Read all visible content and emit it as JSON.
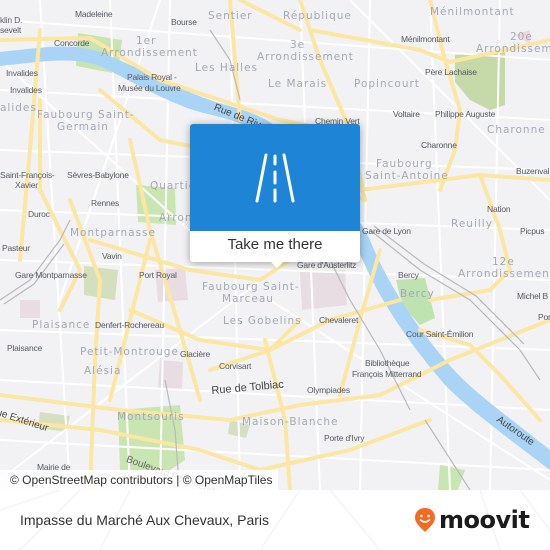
{
  "map": {
    "districts": [
      {
        "text": "Sentier"
      },
      {
        "text": "République"
      },
      {
        "text": "Ménilmontant"
      },
      {
        "text": "1er"
      },
      {
        "text": "Arrondissement"
      },
      {
        "text": "3e"
      },
      {
        "text": "Arrondissement"
      },
      {
        "text": "20e"
      },
      {
        "text": "Arrondissement"
      },
      {
        "text": "Les Halles"
      },
      {
        "text": "Le Marais"
      },
      {
        "text": "Popincourt"
      },
      {
        "text": "Charonne"
      },
      {
        "text": "Faubourg Saint-"
      },
      {
        "text": "Germain"
      },
      {
        "text": "Faubourg"
      },
      {
        "text": "Saint-Antoine"
      },
      {
        "text": "Quartie"
      },
      {
        "text": "Arron"
      },
      {
        "text": "Montparnasse"
      },
      {
        "text": "Reuilly"
      },
      {
        "text": "12e"
      },
      {
        "text": "Arrondissement"
      },
      {
        "text": "Bercy"
      },
      {
        "text": "Faubourg Saint-"
      },
      {
        "text": "Marceau"
      },
      {
        "text": "Les Gobelins"
      },
      {
        "text": "Plaisance"
      },
      {
        "text": "Petit-Montrouge"
      },
      {
        "text": "Alésia"
      },
      {
        "text": "Montsouris"
      },
      {
        "text": "Maison-Blanche"
      },
      {
        "text": "alides"
      }
    ],
    "stations": [
      {
        "text": "Madeleine"
      },
      {
        "text": "Bourse"
      },
      {
        "text": "Concorde"
      },
      {
        "text": "Palais Royal -"
      },
      {
        "text": "Musée du Louvre"
      },
      {
        "text": "Invalides"
      },
      {
        "text": "Invalides"
      },
      {
        "text": "Ménilmontant"
      },
      {
        "text": "Père Lachaise"
      },
      {
        "text": "Chemin Vert"
      },
      {
        "text": "Voltaire"
      },
      {
        "text": "Philippe Auguste"
      },
      {
        "text": "Charonne"
      },
      {
        "text": "Buzenval"
      },
      {
        "text": "Saint-François-"
      },
      {
        "text": "Xavier"
      },
      {
        "text": "Sèvres-Babylone"
      },
      {
        "text": "Rennes"
      },
      {
        "text": "Duroc"
      },
      {
        "text": "Pasteur"
      },
      {
        "text": "Vavin"
      },
      {
        "text": "Gare Montparnasse"
      },
      {
        "text": "Port Royal"
      },
      {
        "text": "Nation"
      },
      {
        "text": "Picpus"
      },
      {
        "text": "Gare de Lyon"
      },
      {
        "text": "Gare d'Austerlitz"
      },
      {
        "text": "Bercy"
      },
      {
        "text": "Michel B"
      },
      {
        "text": "Por"
      },
      {
        "text": "Chevaleret"
      },
      {
        "text": "Cour Saint-Émilion"
      },
      {
        "text": "Denfert-Rochereau"
      },
      {
        "text": "Plaisance"
      },
      {
        "text": "Glacière"
      },
      {
        "text": "Corvisart"
      },
      {
        "text": "Bibliothèque"
      },
      {
        "text": "François Mitterrand"
      },
      {
        "text": "Olympiades"
      },
      {
        "text": "Porte d'Ivry"
      },
      {
        "text": "Mairie de"
      },
      {
        "text": "klin D."
      },
      {
        "text": "sevelt"
      }
    ],
    "streets": [
      {
        "text": "Rue de Rivoli"
      },
      {
        "text": "Rue de Tolbiac"
      },
      {
        "text": "ue Extérieur"
      },
      {
        "text": "Boulevard Périphérique Extérieur"
      },
      {
        "text": "Autoroute"
      }
    ],
    "attribution": "© OpenStreetMap contributors | © OpenMapTiles"
  },
  "popup": {
    "icon": "road-icon",
    "action_label": "Take me there",
    "color": "#1e84d6"
  },
  "footer": {
    "location_title": "Impasse du Marché Aux Chevaux, Paris",
    "brand": "moovit",
    "brand_color": "#f26b21"
  }
}
